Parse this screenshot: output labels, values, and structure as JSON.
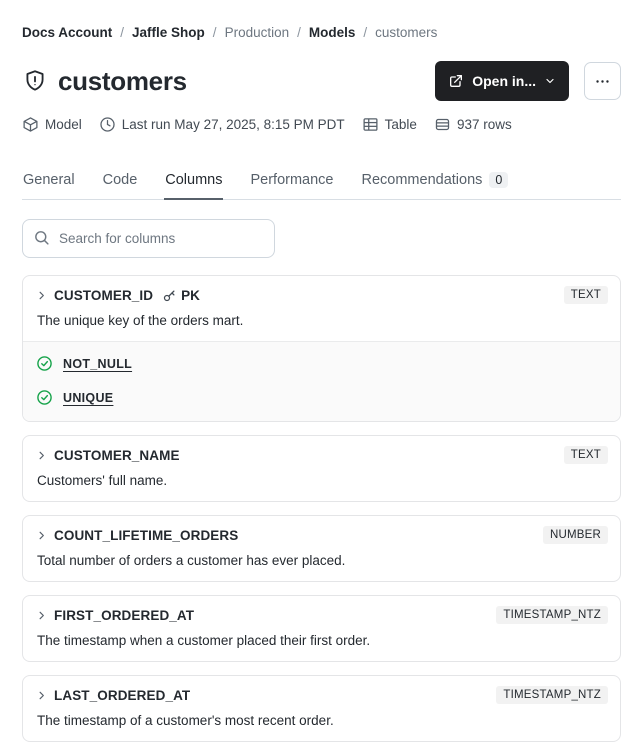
{
  "breadcrumb": {
    "separator": "/",
    "items": [
      {
        "label": "Docs Account",
        "emphasis": true
      },
      {
        "label": "Jaffle Shop",
        "emphasis": true
      },
      {
        "label": "Production",
        "emphasis": false
      },
      {
        "label": "Models",
        "emphasis": true
      },
      {
        "label": "customers",
        "emphasis": false
      }
    ]
  },
  "header": {
    "title": "customers",
    "title_icon": "shield-exclamation-icon",
    "open_in_label": "Open in...",
    "more_icon": "ellipsis-icon"
  },
  "metadata": [
    {
      "icon": "cube-icon",
      "label": "Model"
    },
    {
      "icon": "clock-icon",
      "label": "Last run May 27, 2025, 8:15 PM PDT"
    },
    {
      "icon": "table-icon",
      "label": "Table"
    },
    {
      "icon": "rows-icon",
      "label": "937 rows"
    }
  ],
  "tabs": [
    {
      "label": "General",
      "active": false
    },
    {
      "label": "Code",
      "active": false
    },
    {
      "label": "Columns",
      "active": true
    },
    {
      "label": "Performance",
      "active": false
    },
    {
      "label": "Recommendations",
      "active": false,
      "badge": "0"
    }
  ],
  "search": {
    "placeholder": "Search for columns"
  },
  "columns": [
    {
      "name": "CUSTOMER_ID",
      "pk_label": "PK",
      "type": "TEXT",
      "description": "The unique key of the orders mart.",
      "tests": [
        "NOT_NULL",
        "UNIQUE"
      ]
    },
    {
      "name": "CUSTOMER_NAME",
      "pk_label": null,
      "type": "TEXT",
      "description": "Customers' full name.",
      "tests": []
    },
    {
      "name": "COUNT_LIFETIME_ORDERS",
      "pk_label": null,
      "type": "NUMBER",
      "description": "Total number of orders a customer has ever placed.",
      "tests": []
    },
    {
      "name": "FIRST_ORDERED_AT",
      "pk_label": null,
      "type": "TIMESTAMP_NTZ",
      "description": "The timestamp when a customer placed their first order.",
      "tests": []
    },
    {
      "name": "LAST_ORDERED_AT",
      "pk_label": null,
      "type": "TIMESTAMP_NTZ",
      "description": "The timestamp of a customer's most recent order.",
      "tests": []
    }
  ],
  "colors": {
    "accent_dark_button": "#1f2023",
    "test_check_green": "#16a34a",
    "badge_bg": "#f2f2f2",
    "tests_bg": "#fafafa",
    "inactive_tab": "#57606a"
  }
}
